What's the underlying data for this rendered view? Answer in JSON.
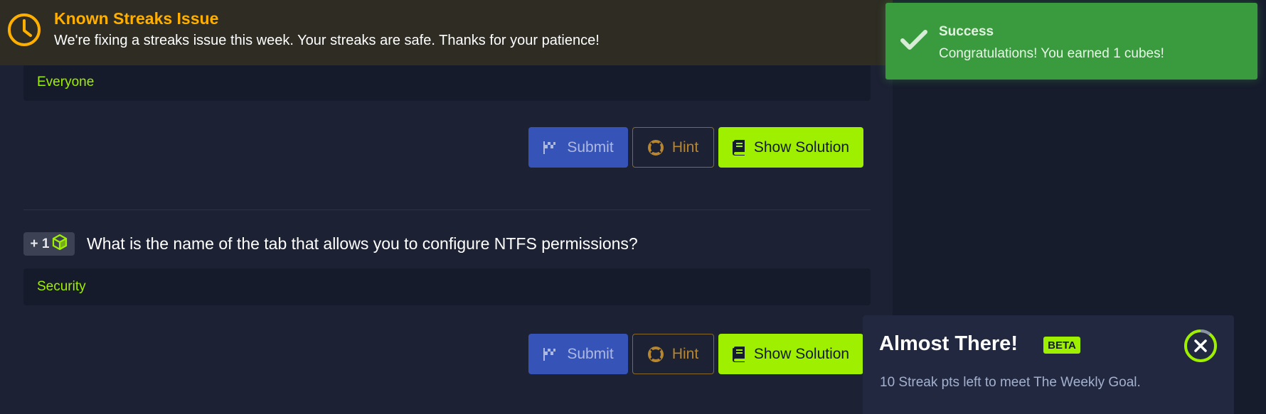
{
  "banner": {
    "title": "Known Streaks Issue",
    "text": "We're fixing a streaks issue this week. Your streaks are safe. Thanks for your patience!",
    "icon": "clock-icon",
    "color": "#ffaf00"
  },
  "question_1": {
    "answer": "Everyone",
    "buttons": {
      "submit": "Submit",
      "hint": "Hint",
      "solution": "Show Solution"
    }
  },
  "question_2": {
    "reward": "+ 1",
    "question": "What is the name of the tab that allows you to configure NTFS permissions?",
    "answer": "Security",
    "buttons": {
      "submit": "Submit",
      "hint": "Hint",
      "solution": "Show Solution"
    }
  },
  "toast": {
    "title": "Success",
    "message": "Congratulations! You earned 1 cubes!",
    "icon": "checkmark-icon",
    "color": "#3a9a3e"
  },
  "streak_card": {
    "title": "Almost There!",
    "badge": "BETA",
    "text": "10 Streak pts left to meet The Weekly Goal.",
    "progress": 0.1
  },
  "colors": {
    "accent": "#9fef00",
    "submit": "#3653b8",
    "hint": "#b8862e",
    "background": "#1c2133"
  }
}
